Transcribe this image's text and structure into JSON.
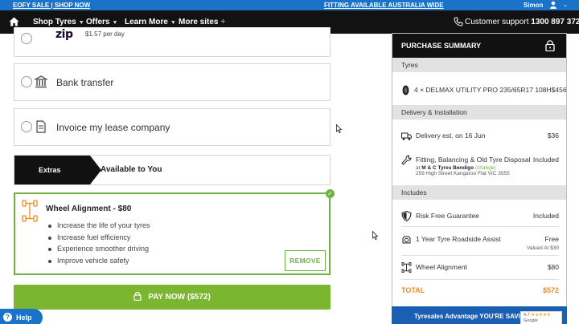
{
  "topbar": {
    "sale_link": "EOFY SALE | SHOP NOW",
    "fitting_link": "FITTING AVAILABLE AUSTRALIA WIDE",
    "user_name": "Simon"
  },
  "nav": {
    "items": [
      {
        "label": "Shop Tyres"
      },
      {
        "label": "Offers"
      },
      {
        "label": "Learn More"
      },
      {
        "label": "More sites",
        "plus": "+"
      }
    ],
    "support_label": "Customer support",
    "support_phone": "1300 897 372"
  },
  "payment": {
    "zip_logo": "zip",
    "zip_text": "$1.57 per day",
    "bank_transfer": "Bank transfer",
    "lease": "Invoice my lease company"
  },
  "extras": {
    "tab_label": "Extras",
    "available_label": "Available to You"
  },
  "alignment": {
    "title": "Wheel Alignment - $80",
    "bullets": [
      "Increase the life of your tyres",
      "Increase fuel efficiency",
      "Experience smoother driving",
      "Improve vehicle safety"
    ],
    "remove_label": "REMOVE",
    "selected": true
  },
  "pay_now": "PAY NOW ($572)",
  "help": "Help",
  "summary": {
    "title": "PURCHASE SUMMARY",
    "tyres_header": "Tyres",
    "tyre_item": "4 × DELMAX UTILITY PRO 235/65R17 108H$456",
    "delivery_header": "Delivery & Installation",
    "delivery_label": "Delivery est. on 16 Jun",
    "delivery_value": "$36",
    "fitting_label": "Fitting, Balancing & Old Tyre Disposal",
    "fitting_value": "Included",
    "fitting_at": "at",
    "fitting_store": "M & C Tyres Bendigo",
    "fitting_change": "(change)",
    "fitting_address": "259 High Street Kangaroo Flat VIC 3555",
    "includes_header": "Includes",
    "guarantee_label": "Risk Free Guarantee",
    "guarantee_value": "Included",
    "roadside_label": "1 Year Tyre Roadside Assist",
    "roadside_value": "Free",
    "roadside_sub": "Valued At $30",
    "alignment_label": "Wheel Alignment",
    "alignment_value": "$80",
    "total_label": "TOTAL",
    "total_value": "$572"
  },
  "advantage_banner": "Tyresales Advantage YOU'RE SAVIN",
  "google_badge": {
    "rating": "4.7",
    "stars": "★★★★★",
    "label": "Google"
  },
  "colors": {
    "brand_blue": "#1a73c8",
    "nav_black": "#121212",
    "accent_green": "#6cb33f",
    "pay_green": "#7bb631",
    "total_orange": "#f08a24"
  }
}
